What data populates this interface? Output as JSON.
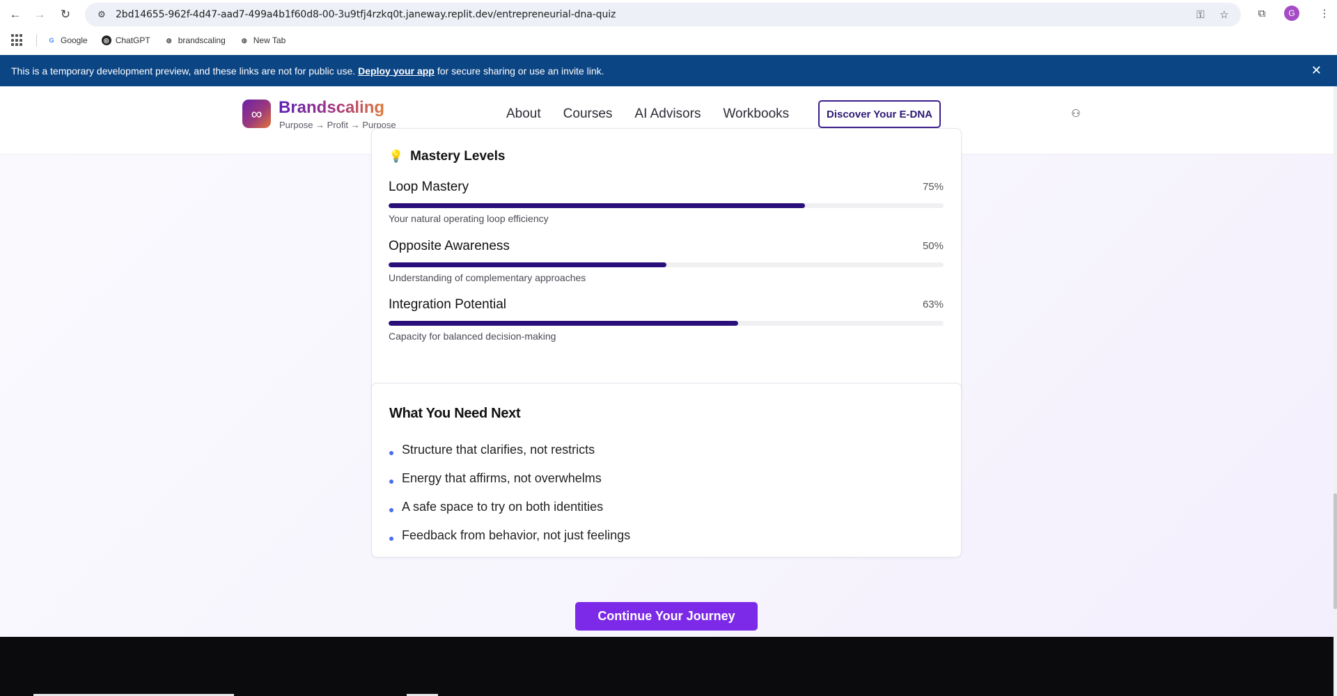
{
  "browser": {
    "url": "2bd14655-962f-4d47-aad7-499a4b1f60d8-00-3u9tfj4rzkq0t.janeway.replit.dev/entrepreneurial-dna-quiz",
    "avatar_letter": "G",
    "bookmarks": [
      {
        "label": "Google",
        "icon": "google-icon"
      },
      {
        "label": "ChatGPT",
        "icon": "chatgpt-icon"
      },
      {
        "label": "brandscaling",
        "icon": "globe-icon"
      },
      {
        "label": "New Tab",
        "icon": "globe-icon"
      }
    ]
  },
  "dev_banner": {
    "text_before": "This is a temporary development preview, and these links are not for public use.",
    "link": "Deploy your app",
    "text_after": "for secure sharing or use an invite link."
  },
  "header": {
    "brand": "Brandscaling",
    "tagline": "Purpose → Profit → Purpose",
    "nav": [
      "About",
      "Courses",
      "AI Advisors",
      "Workbooks"
    ],
    "cta": "Discover Your E-DNA"
  },
  "mastery": {
    "title": "Mastery Levels",
    "levels": [
      {
        "name": "Loop Mastery",
        "percent_label": "75%",
        "value": 0.75,
        "desc": "Your natural operating loop efficiency"
      },
      {
        "name": "Opposite Awareness",
        "percent_label": "50%",
        "value": 0.5,
        "desc": "Understanding of complementary approaches"
      },
      {
        "name": "Integration Potential",
        "percent_label": "63%",
        "value": 0.63,
        "desc": "Capacity for balanced decision-making"
      }
    ]
  },
  "next": {
    "title": "What You Need Next",
    "items": [
      "Structure that clarifies, not restricts",
      "Energy that affirms, not overwhelms",
      "A safe space to try on both identities",
      "Feedback from behavior, not just feelings"
    ]
  },
  "continue_label": "Continue Your Journey",
  "colors": {
    "banner": "#0c4584",
    "progress": "#2a0f7a",
    "cta": "#7c2ae8",
    "bullet": "#4a6cf0"
  }
}
